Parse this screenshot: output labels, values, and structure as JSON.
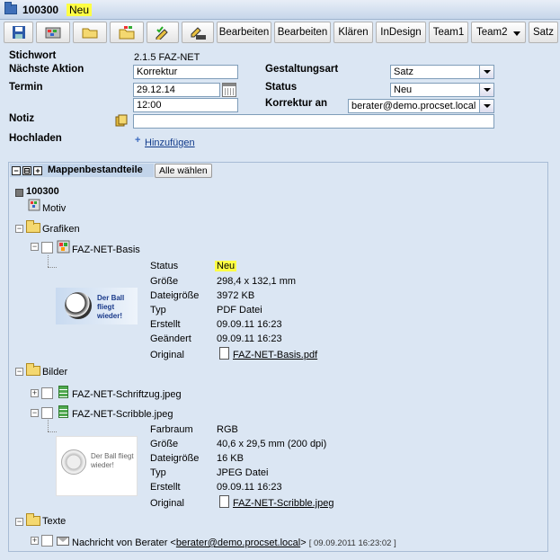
{
  "title": {
    "number": "100300",
    "badge": "Neu"
  },
  "toolbar": {
    "icons": [
      "save-icon",
      "color-image-icon",
      "folder-open-icon",
      "color-image-folder-icon",
      "check-pencil-icon",
      "log-pencil-icon"
    ],
    "buttons": [
      "Bearbeiten",
      "Bearbeiten",
      "Klären",
      "InDesign",
      "Team1",
      "Team2",
      "Satz"
    ]
  },
  "form": {
    "stichwort_label": "Stichwort",
    "stichwort_value": "2.1.5 FAZ-NET",
    "aktion_label": "Nächste Aktion",
    "aktion_value": "Korrektur",
    "termin_label": "Termin",
    "termin_date": "29.12.14",
    "termin_time": "12:00",
    "gestaltung_label": "Gestaltungsart",
    "gestaltung_value": "Satz",
    "status_label": "Status",
    "status_value": "Neu",
    "korrektur_label": "Korrektur an",
    "korrektur_value": "berater@demo.procset.local",
    "notiz_label": "Notiz",
    "notiz_value": "",
    "hochladen_label": "Hochladen",
    "hinzufuegen": "Hinzufügen"
  },
  "panel": {
    "title": "Mappenbestandteile",
    "select_all": "Alle wählen",
    "root": "100300",
    "motiv": "Motiv",
    "grafiken": "Grafiken",
    "grafik_file": "FAZ-NET-Basis",
    "grafik_thumb_text": "Der Ball fliegt wieder!",
    "grafik_props": {
      "labels": [
        "Status",
        "Größe",
        "Dateigröße",
        "Typ",
        "Erstellt",
        "Geändert",
        "Original"
      ],
      "values": [
        "Neu",
        "298,4 x 132,1 mm",
        "3972 KB",
        "PDF Datei",
        "09.09.11 16:23",
        "09.09.11 16:23",
        "FAZ-NET-Basis.pdf"
      ]
    },
    "bilder": "Bilder",
    "bild1": "FAZ-NET-Schriftzug.jpeg",
    "bild2": "FAZ-NET-Scribble.jpeg",
    "bild_thumb_text": "Der Ball fliegt wieder!",
    "bild_props": {
      "labels": [
        "Farbraum",
        "Größe",
        "Dateigröße",
        "Typ",
        "Erstellt",
        "Original"
      ],
      "values": [
        "RGB",
        "40,6 x 29,5 mm (200 dpi)",
        "16 KB",
        "JPEG Datei",
        "09.09.11 16:23",
        "FAZ-NET-Scribble.jpeg"
      ]
    },
    "texte": "Texte",
    "nachricht_prefix": "Nachricht von Berater <",
    "nachricht_email": "berater@demo.procset.local",
    "nachricht_suffix": ">",
    "nachricht_date": "[ 09.09.2011 16:23:02 ]"
  }
}
